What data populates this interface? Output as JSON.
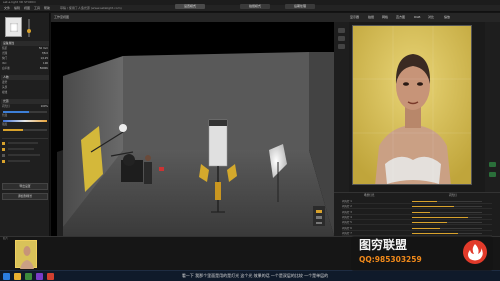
{
  "window": {
    "title": "set.a.light 3D STUDIO"
  },
  "menu": {
    "items": [
      "文件",
      "编辑",
      "视图",
      "工具",
      "帮助"
    ],
    "doc_title": "草稿 / 使用了人造光源 (www.setalight.com)",
    "tabs": [
      "设置模式",
      "拍摄模式",
      "后期处理"
    ]
  },
  "left_panel": {
    "sections": [
      {
        "title": "设备属性",
        "rows": [
          {
            "label": "焦距",
            "value": "50 mm"
          },
          {
            "label": "光圈",
            "value": "f/8.0"
          },
          {
            "label": "快门",
            "value": "1/125"
          },
          {
            "label": "ISO",
            "value": "100"
          },
          {
            "label": "白平衡",
            "value": "5600K"
          }
        ]
      },
      {
        "title": "人物",
        "rows": [
          {
            "label": "姿势",
            "value": ""
          },
          {
            "label": "头部",
            "value": ""
          },
          {
            "label": "视线",
            "value": ""
          }
        ]
      },
      {
        "title": "光源",
        "rows": [
          {
            "label": "闪光灯",
            "value": "100%"
          },
          {
            "label": "色温",
            "value": ""
          },
          {
            "label": "强度",
            "value": ""
          }
        ]
      }
    ],
    "footer_button": "导出设置",
    "footer_button2": "添加到场景"
  },
  "viewport": {
    "header": "工作室视图"
  },
  "right_panel": {
    "header_items": [
      "显示器",
      "拍摄",
      "网格",
      "直方图",
      "RGB",
      "对比",
      "缩放"
    ],
    "lower_tabs": [
      "场景灯光",
      "闪光灯"
    ],
    "light_rows": [
      {
        "label": "闪光灯 1",
        "value": 0.35
      },
      {
        "label": "闪光灯 2",
        "value": 0.6
      },
      {
        "label": "闪光灯 3",
        "value": 0.25
      },
      {
        "label": "闪光灯 4",
        "value": 0.8
      },
      {
        "label": "闪光灯 5",
        "value": 0.5
      },
      {
        "label": "闪光灯 6",
        "value": 0.4
      },
      {
        "label": "闪光灯 7",
        "value": 0.65
      }
    ]
  },
  "filmstrip": {
    "label": "胶片"
  },
  "subtitle": "看一下 我那个里面是用的是灯光 这个光 效果的话 一个是双层的比较 一个是单层的",
  "watermark": {
    "title": "图穷联盟",
    "contact": "QQ:985303259"
  },
  "colors": {
    "backdrop_yellow": "#d9c259",
    "accent_orange": "#d8a22c",
    "brand_red": "#e23a2a",
    "brand_orange": "#f28a1a"
  }
}
